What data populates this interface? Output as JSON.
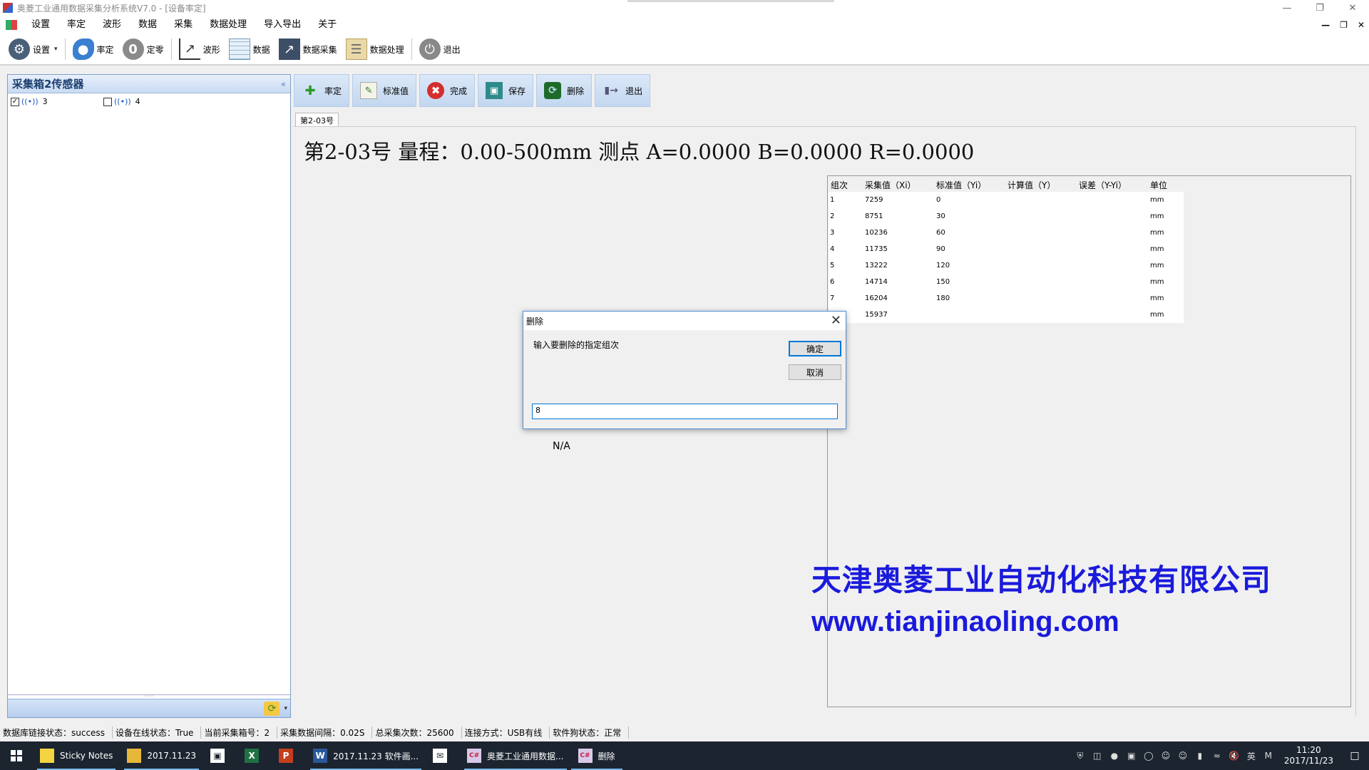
{
  "window": {
    "title": "奥菱工业通用数据采集分析系统V7.0 - [设备率定]"
  },
  "menu": {
    "items": [
      "设置",
      "率定",
      "波形",
      "数据",
      "采集",
      "数据处理",
      "导入导出",
      "关于"
    ]
  },
  "toolbar": {
    "settings": "设置",
    "calibrate": "率定",
    "zero": "定零",
    "waveform": "波形",
    "data": "数据",
    "data_collect": "数据采集",
    "data_process": "数据处理",
    "exit": "退出",
    "zero_glyph": "0"
  },
  "left_panel": {
    "title": "采集箱2传感器",
    "collapse": "«",
    "sensors": [
      {
        "label": "3",
        "checked": true
      },
      {
        "label": "4",
        "checked": false
      }
    ]
  },
  "actions": {
    "calibrate": "率定",
    "standard_value": "标准值",
    "done": "完成",
    "save": "保存",
    "delete": "删除",
    "exit": "退出"
  },
  "tab": {
    "label": "第2-03号"
  },
  "heading": "第2-03号 量程：0.00-500mm 测点 A=0.0000 B=0.0000 R=0.0000",
  "na_text": "N/A",
  "table": {
    "headers": [
      "组次",
      "采集值（Xi）",
      "标准值（Yi）",
      "计算值（Y）",
      "误差（Y-Yi）",
      "单位"
    ],
    "rows": [
      {
        "group": "1",
        "xi": "7259",
        "yi": "0",
        "y": "",
        "err": "",
        "unit": "mm"
      },
      {
        "group": "2",
        "xi": "8751",
        "yi": "30",
        "y": "",
        "err": "",
        "unit": "mm"
      },
      {
        "group": "3",
        "xi": "10236",
        "yi": "60",
        "y": "",
        "err": "",
        "unit": "mm"
      },
      {
        "group": "4",
        "xi": "11735",
        "yi": "90",
        "y": "",
        "err": "",
        "unit": "mm"
      },
      {
        "group": "5",
        "xi": "13222",
        "yi": "120",
        "y": "",
        "err": "",
        "unit": "mm"
      },
      {
        "group": "6",
        "xi": "14714",
        "yi": "150",
        "y": "",
        "err": "",
        "unit": "mm"
      },
      {
        "group": "7",
        "xi": "16204",
        "yi": "180",
        "y": "",
        "err": "",
        "unit": "mm"
      },
      {
        "group": "",
        "xi": "15937",
        "yi": "",
        "y": "",
        "err": "",
        "unit": "mm"
      }
    ]
  },
  "watermark": {
    "company": "天津奥菱工业自动化科技有限公司",
    "url": "www.tianjinaoling.com"
  },
  "dialog": {
    "title": "删除",
    "prompt": "输入要删除的指定组次",
    "ok": "确定",
    "cancel": "取消",
    "input_value": "8"
  },
  "status": {
    "db_link": "数据库链接状态：success",
    "device_online": "设备在线状态：True",
    "box_no": "当前采集箱号：2",
    "interval": "采集数据间隔：0.02S",
    "total": "总采集次数：25600",
    "conn": "连接方式：USB有线",
    "dongle": "软件狗状态：正常"
  },
  "taskbar": {
    "items": [
      {
        "label": "Sticky Notes",
        "icon": "sticky-notes-icon"
      },
      {
        "label": "2017.11.23",
        "icon": "folder-icon"
      },
      {
        "label": "",
        "icon": "store-icon"
      },
      {
        "label": "",
        "icon": "excel-icon"
      },
      {
        "label": "",
        "icon": "powerpoint-icon"
      },
      {
        "label": "2017.11.23 软件画...",
        "icon": "word-icon"
      },
      {
        "label": "",
        "icon": "mail-icon"
      },
      {
        "label": "奥菱工业通用数据...",
        "icon": "app-icon"
      },
      {
        "label": "删除",
        "icon": "app-icon"
      }
    ],
    "ime": "英",
    "clock_time": "11:20",
    "clock_date": "2017/11/23"
  },
  "colors": {
    "watermark": "#1a1adc",
    "dialog_border": "#4f8ed8",
    "taskbar": "#1c2430"
  }
}
